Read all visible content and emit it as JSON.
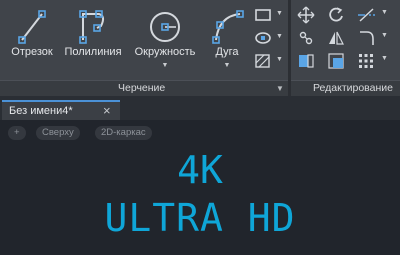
{
  "ribbon": {
    "draw_panel": {
      "title": "Черчение",
      "tools": [
        {
          "label": "Отрезок",
          "icon": "line-icon"
        },
        {
          "label": "Полилиния",
          "icon": "polyline-icon"
        },
        {
          "label": "Окружность",
          "icon": "circle-icon"
        },
        {
          "label": "Дуга",
          "icon": "arc-icon"
        }
      ],
      "small_tools": [
        "rectangle-icon",
        "ellipse-icon",
        "hatch-icon"
      ]
    },
    "edit_panel": {
      "title": "Редактирование",
      "small_tools": [
        "move-icon",
        "rotate-icon",
        "trim-icon",
        "copy-icon",
        "mirror-icon",
        "fillet-icon",
        "stretch-icon",
        "scale-icon",
        "array-icon"
      ]
    },
    "accent_color": "#4b91d6"
  },
  "tabs": {
    "active": {
      "label": "Без имени4*",
      "close": "×"
    }
  },
  "viewport": {
    "controls": [
      "+",
      "Сверху",
      "2D-каркас"
    ],
    "text_color": "#0fa6d8",
    "headline_line1": "4K",
    "headline_line2": "ULTRA HD"
  }
}
